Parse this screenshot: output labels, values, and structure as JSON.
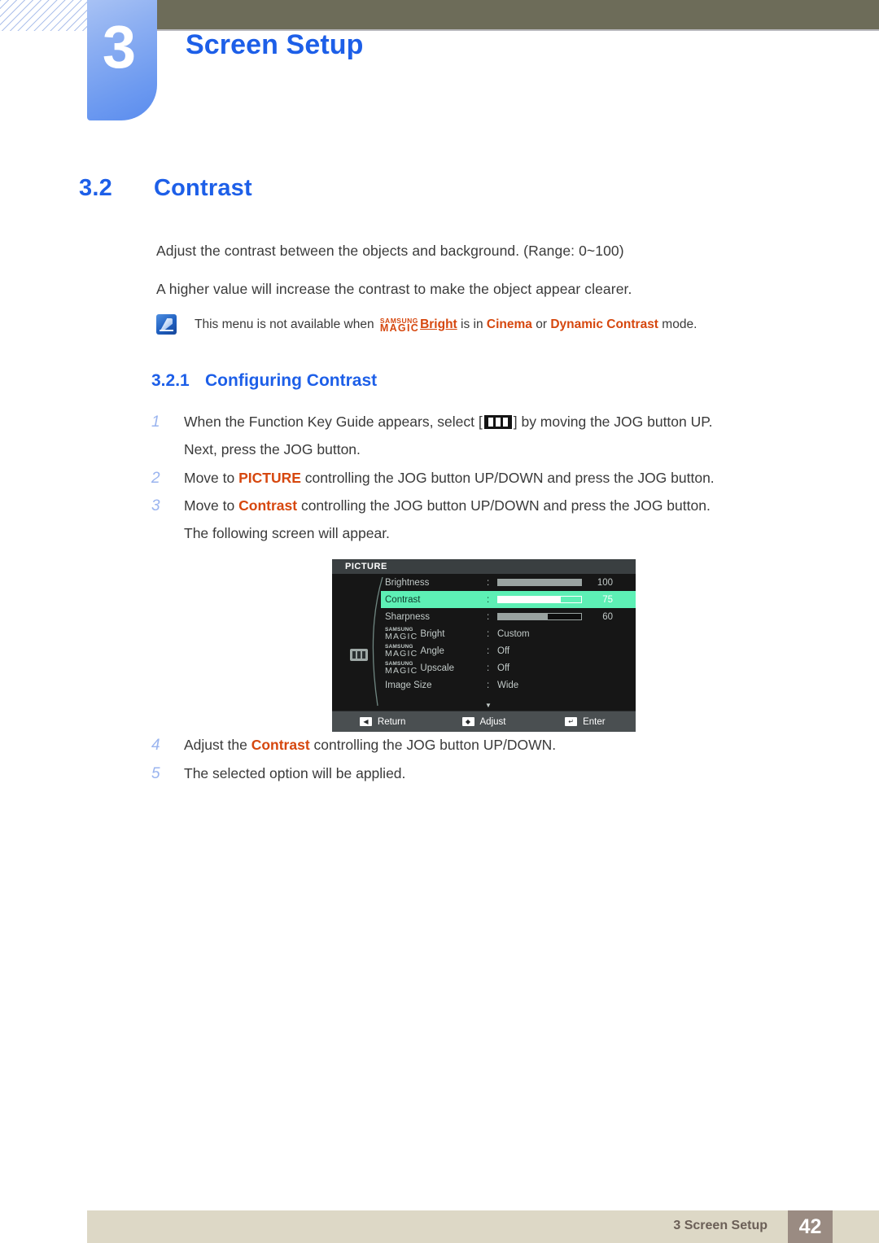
{
  "header": {
    "chapter_number": "3",
    "chapter_title": "Screen Setup"
  },
  "section": {
    "number": "3.2",
    "title": "Contrast",
    "paragraph_1": "Adjust the contrast between the objects and background. (Range: 0~100)",
    "paragraph_2": "A higher value will increase the contrast to make the object appear clearer."
  },
  "note": {
    "icon": "note-pencil-icon",
    "text_before": "This menu is not available when",
    "magic_small": "SAMSUNG",
    "magic_large": "MAGIC",
    "magic_suffix": "Bright",
    "text_mid": "is in",
    "mode_1": "Cinema",
    "text_or": "or",
    "mode_2": "Dynamic Contrast",
    "text_after": "mode."
  },
  "subsection": {
    "number": "3.2.1",
    "title": "Configuring Contrast"
  },
  "steps": [
    {
      "index": "1",
      "text_before": "When the Function Key Guide appears, select [",
      "glyph": "jog-key-guide-icon",
      "text_after": "] by moving the JOG button UP.",
      "continuation": "Next, press the JOG button."
    },
    {
      "index": "2",
      "text_before": "Move to ",
      "highlight": "PICTURE",
      "text_after": " controlling the JOG button UP/DOWN and press the JOG button."
    },
    {
      "index": "3",
      "text_before": "Move to ",
      "highlight": "Contrast",
      "text_after": " controlling the JOG button UP/DOWN and press the JOG button.",
      "continuation": "The following screen will appear."
    },
    {
      "index": "4",
      "text_before": "Adjust the ",
      "highlight": "Contrast",
      "text_after": " controlling the JOG button UP/DOWN."
    },
    {
      "index": "5",
      "text_before": "The selected option will be applied.",
      "highlight": "",
      "text_after": ""
    }
  ],
  "osd": {
    "title": "PICTURE",
    "category_icon": "picture-category-icon",
    "rows": [
      {
        "label": "Brightness",
        "colon": ":",
        "type": "bar",
        "percent": 100,
        "value": "100",
        "selected": false
      },
      {
        "label": "Contrast",
        "colon": ":",
        "type": "bar",
        "percent": 75,
        "value": "75",
        "selected": true
      },
      {
        "label": "Sharpness",
        "colon": ":",
        "type": "bar",
        "percent": 60,
        "value": "60",
        "selected": false
      },
      {
        "label_small": "SAMSUNG",
        "label_magic": "MAGIC",
        "label": "Bright",
        "colon": ":",
        "type": "text",
        "value": "Custom",
        "selected": false
      },
      {
        "label_small": "SAMSUNG",
        "label_magic": "MAGIC",
        "label": "Angle",
        "colon": ":",
        "type": "text",
        "value": "Off",
        "selected": false
      },
      {
        "label_small": "SAMSUNG",
        "label_magic": "MAGIC",
        "label": "Upscale",
        "colon": ":",
        "type": "text",
        "value": "Off",
        "selected": false
      },
      {
        "label": "Image Size",
        "colon": ":",
        "type": "text",
        "value": "Wide",
        "selected": false
      }
    ],
    "more_indicator": "▼",
    "footer": [
      {
        "key": "◀",
        "label": "Return"
      },
      {
        "key": "◆",
        "label": "Adjust"
      },
      {
        "key": "↵",
        "label": "Enter"
      }
    ]
  },
  "footer": {
    "text": "3 Screen Setup",
    "page": "42"
  },
  "colors": {
    "brand_blue": "#1d5fe8",
    "tab_blue": "#6d9af0",
    "olive": "#6d6c59",
    "orange": "#d6470e",
    "osd_green": "#5df0b5",
    "footer_tan": "#ddd8c6",
    "footer_page": "#9a8b82"
  }
}
